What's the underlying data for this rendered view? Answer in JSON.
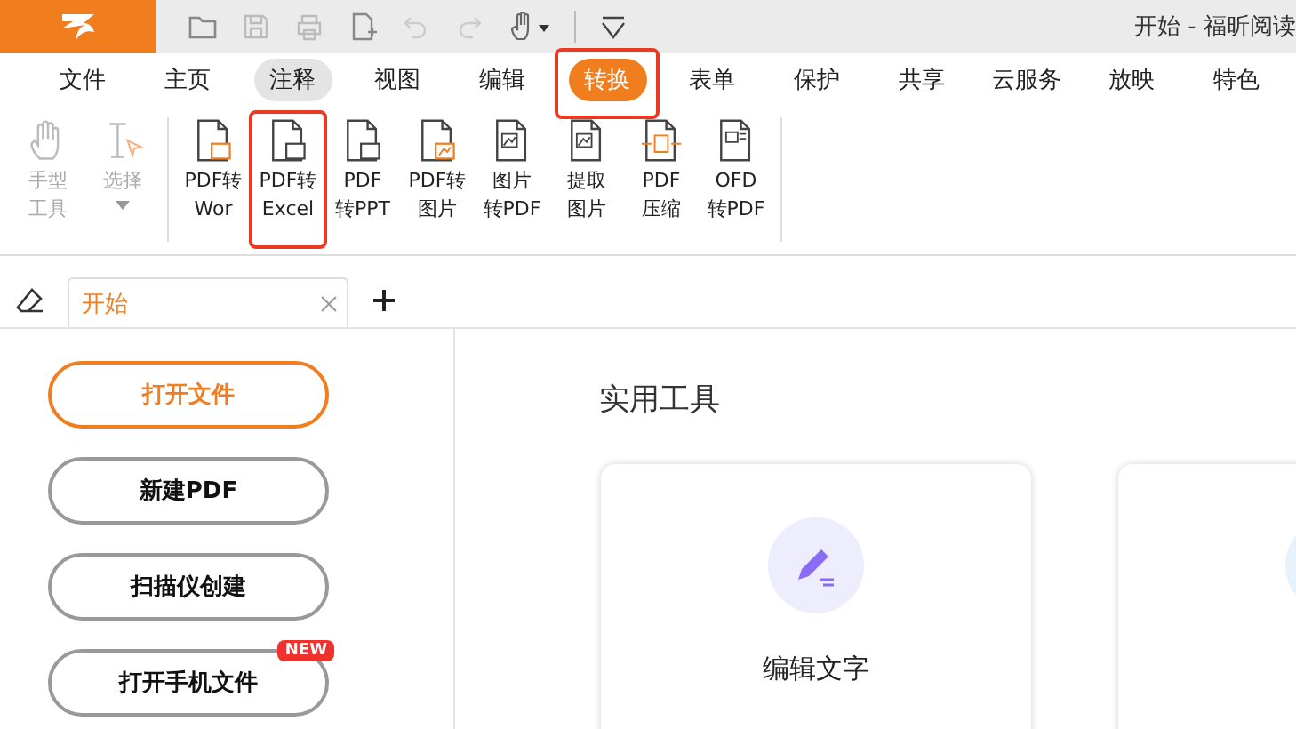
{
  "window": {
    "title": "开始 - 福昕阅读"
  },
  "menu": [
    {
      "label": "文件",
      "selected": false,
      "hovered": false,
      "highlighted": false
    },
    {
      "label": "主页",
      "selected": false,
      "hovered": false,
      "highlighted": false
    },
    {
      "label": "注释",
      "selected": false,
      "hovered": true,
      "highlighted": false
    },
    {
      "label": "视图",
      "selected": false,
      "hovered": false,
      "highlighted": false
    },
    {
      "label": "编辑",
      "selected": false,
      "hovered": false,
      "highlighted": false
    },
    {
      "label": "转换",
      "selected": true,
      "hovered": false,
      "highlighted": true
    },
    {
      "label": "表单",
      "selected": false,
      "hovered": false,
      "highlighted": false
    },
    {
      "label": "保护",
      "selected": false,
      "hovered": false,
      "highlighted": false
    },
    {
      "label": "共享",
      "selected": false,
      "hovered": false,
      "highlighted": false
    },
    {
      "label": "云服务",
      "selected": false,
      "hovered": false,
      "highlighted": false
    },
    {
      "label": "放映",
      "selected": false,
      "hovered": false,
      "highlighted": false
    },
    {
      "label": "特色",
      "selected": false,
      "hovered": false,
      "highlighted": false
    }
  ],
  "ribbon": [
    {
      "kind": "hand",
      "lines": [
        "手型",
        "工具"
      ],
      "disabled": true,
      "highlighted": false
    },
    {
      "kind": "select",
      "lines": [
        "选择"
      ],
      "disabled": true,
      "highlighted": false
    },
    {
      "kind": "word",
      "lines": [
        "PDF转",
        "Wor"
      ],
      "disabled": false,
      "highlighted": false
    },
    {
      "kind": "excel",
      "lines": [
        "PDF转",
        "Excel"
      ],
      "disabled": false,
      "highlighted": true
    },
    {
      "kind": "ppt",
      "lines": [
        "PDF",
        "转PPT"
      ],
      "disabled": false,
      "highlighted": false
    },
    {
      "kind": "image",
      "lines": [
        "PDF转",
        "图片"
      ],
      "disabled": false,
      "highlighted": false
    },
    {
      "kind": "img2pdf",
      "lines": [
        "图片",
        "转PDF"
      ],
      "disabled": false,
      "highlighted": false
    },
    {
      "kind": "extract",
      "lines": [
        "提取",
        "图片"
      ],
      "disabled": false,
      "highlighted": false
    },
    {
      "kind": "compress",
      "lines": [
        "PDF",
        "压缩"
      ],
      "disabled": false,
      "highlighted": false
    },
    {
      "kind": "ofd",
      "lines": [
        "OFD",
        "转PDF"
      ],
      "disabled": false,
      "highlighted": false
    }
  ],
  "doc_tabs": [
    {
      "label": "开始",
      "selected": true
    }
  ],
  "actions": [
    {
      "label": "打开文件",
      "primary": true
    },
    {
      "label": "新建PDF",
      "primary": false
    },
    {
      "label": "扫描仪创建",
      "primary": false
    },
    {
      "label": "打开手机文件",
      "primary": false,
      "badge": "NEW"
    }
  ],
  "tools": {
    "title": "实用工具",
    "cards": [
      {
        "kind": "edit",
        "label": "编辑文字"
      },
      {
        "kind": "split"
      }
    ]
  }
}
